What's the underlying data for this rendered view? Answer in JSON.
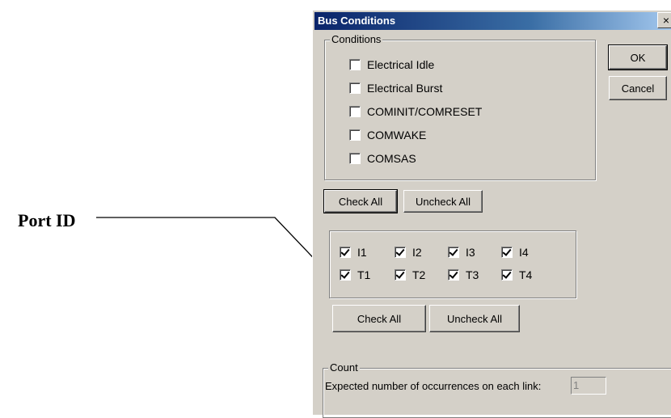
{
  "annotation": {
    "label": "Port ID"
  },
  "dialog": {
    "title": "Bus Conditions",
    "close_glyph": "×",
    "ok_label": "OK",
    "cancel_label": "Cancel",
    "conditions": {
      "group_title": "Conditions",
      "items": [
        {
          "label": "Electrical Idle",
          "checked": false
        },
        {
          "label": "Electrical Burst",
          "checked": false
        },
        {
          "label": "COMINIT/COMRESET",
          "checked": false
        },
        {
          "label": "COMWAKE",
          "checked": false
        },
        {
          "label": "COMSAS",
          "checked": false
        }
      ],
      "check_all_label": "Check All",
      "uncheck_all_label": "Uncheck All"
    },
    "ports": {
      "items": [
        {
          "label": "I1",
          "checked": true
        },
        {
          "label": "I2",
          "checked": true
        },
        {
          "label": "I3",
          "checked": true
        },
        {
          "label": "I4",
          "checked": true
        },
        {
          "label": "T1",
          "checked": true
        },
        {
          "label": "T2",
          "checked": true
        },
        {
          "label": "T3",
          "checked": true
        },
        {
          "label": "T4",
          "checked": true
        }
      ],
      "check_all_label": "Check All",
      "uncheck_all_label": "Uncheck All"
    },
    "count": {
      "group_title": "Count",
      "field_label": "Expected number of occurrences on each link:",
      "field_value": "1"
    }
  }
}
